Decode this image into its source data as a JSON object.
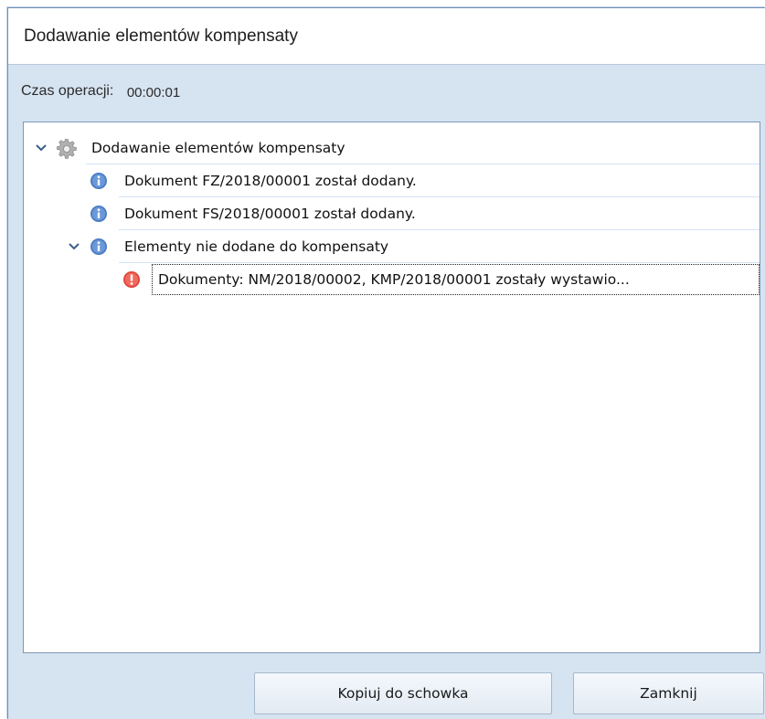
{
  "window": {
    "title": "Dodawanie elementów kompensaty"
  },
  "operation_time": {
    "label": "Czas operacji:",
    "value": "00:00:01"
  },
  "tree": {
    "nodes": [
      {
        "label": "Dodawanie elementów kompensaty",
        "icon": "gear-icon",
        "expanded": true,
        "level": 0
      },
      {
        "label": "Dokument FZ/2018/00001 został dodany.",
        "icon": "info-icon",
        "level": 1
      },
      {
        "label": "Dokument FS/2018/00001 został dodany.",
        "icon": "info-icon",
        "level": 1
      },
      {
        "label": "Elementy nie dodane do kompensaty",
        "icon": "info-icon",
        "expanded": true,
        "level": 1
      },
      {
        "label": "Dokumenty: NM/2018/00002, KMP/2018/00001 zostały wystawio...",
        "icon": "error-icon",
        "level": 2,
        "selected": true
      }
    ]
  },
  "buttons": {
    "copy": "Kopiuj do schowka",
    "close": "Zamknij"
  },
  "colors": {
    "window_bg": "#d6e3f1",
    "info_blue": "#4a7cc4",
    "error_red": "#e0443a",
    "border": "#7f97b4"
  }
}
